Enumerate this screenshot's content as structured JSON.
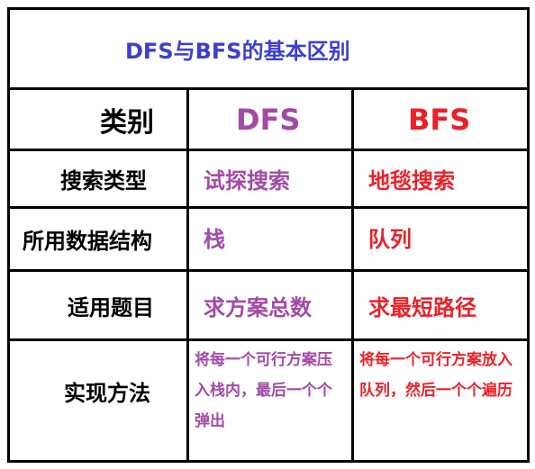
{
  "title": "DFS与BFS的基本区别",
  "header": {
    "category": "类别",
    "dfs": "DFS",
    "bfs": "BFS"
  },
  "rows": [
    {
      "label": "搜索类型",
      "dfs": "试探搜索",
      "bfs": "地毯搜索"
    },
    {
      "label": "所用数据结构",
      "dfs": "栈",
      "bfs": "队列"
    },
    {
      "label": "适用题目",
      "dfs": "求方案总数",
      "bfs": "求最短路径"
    },
    {
      "label": "实现方法",
      "dfs": "将每一个可行方案压入栈内，最后一个个弹出",
      "bfs": "将每一个可行方案放入队列，然后一个个遍历"
    }
  ],
  "colors": {
    "dfs": "#a24aa6",
    "bfs": "#e8222a",
    "title": "#3b3fd0",
    "border": "#000000"
  }
}
